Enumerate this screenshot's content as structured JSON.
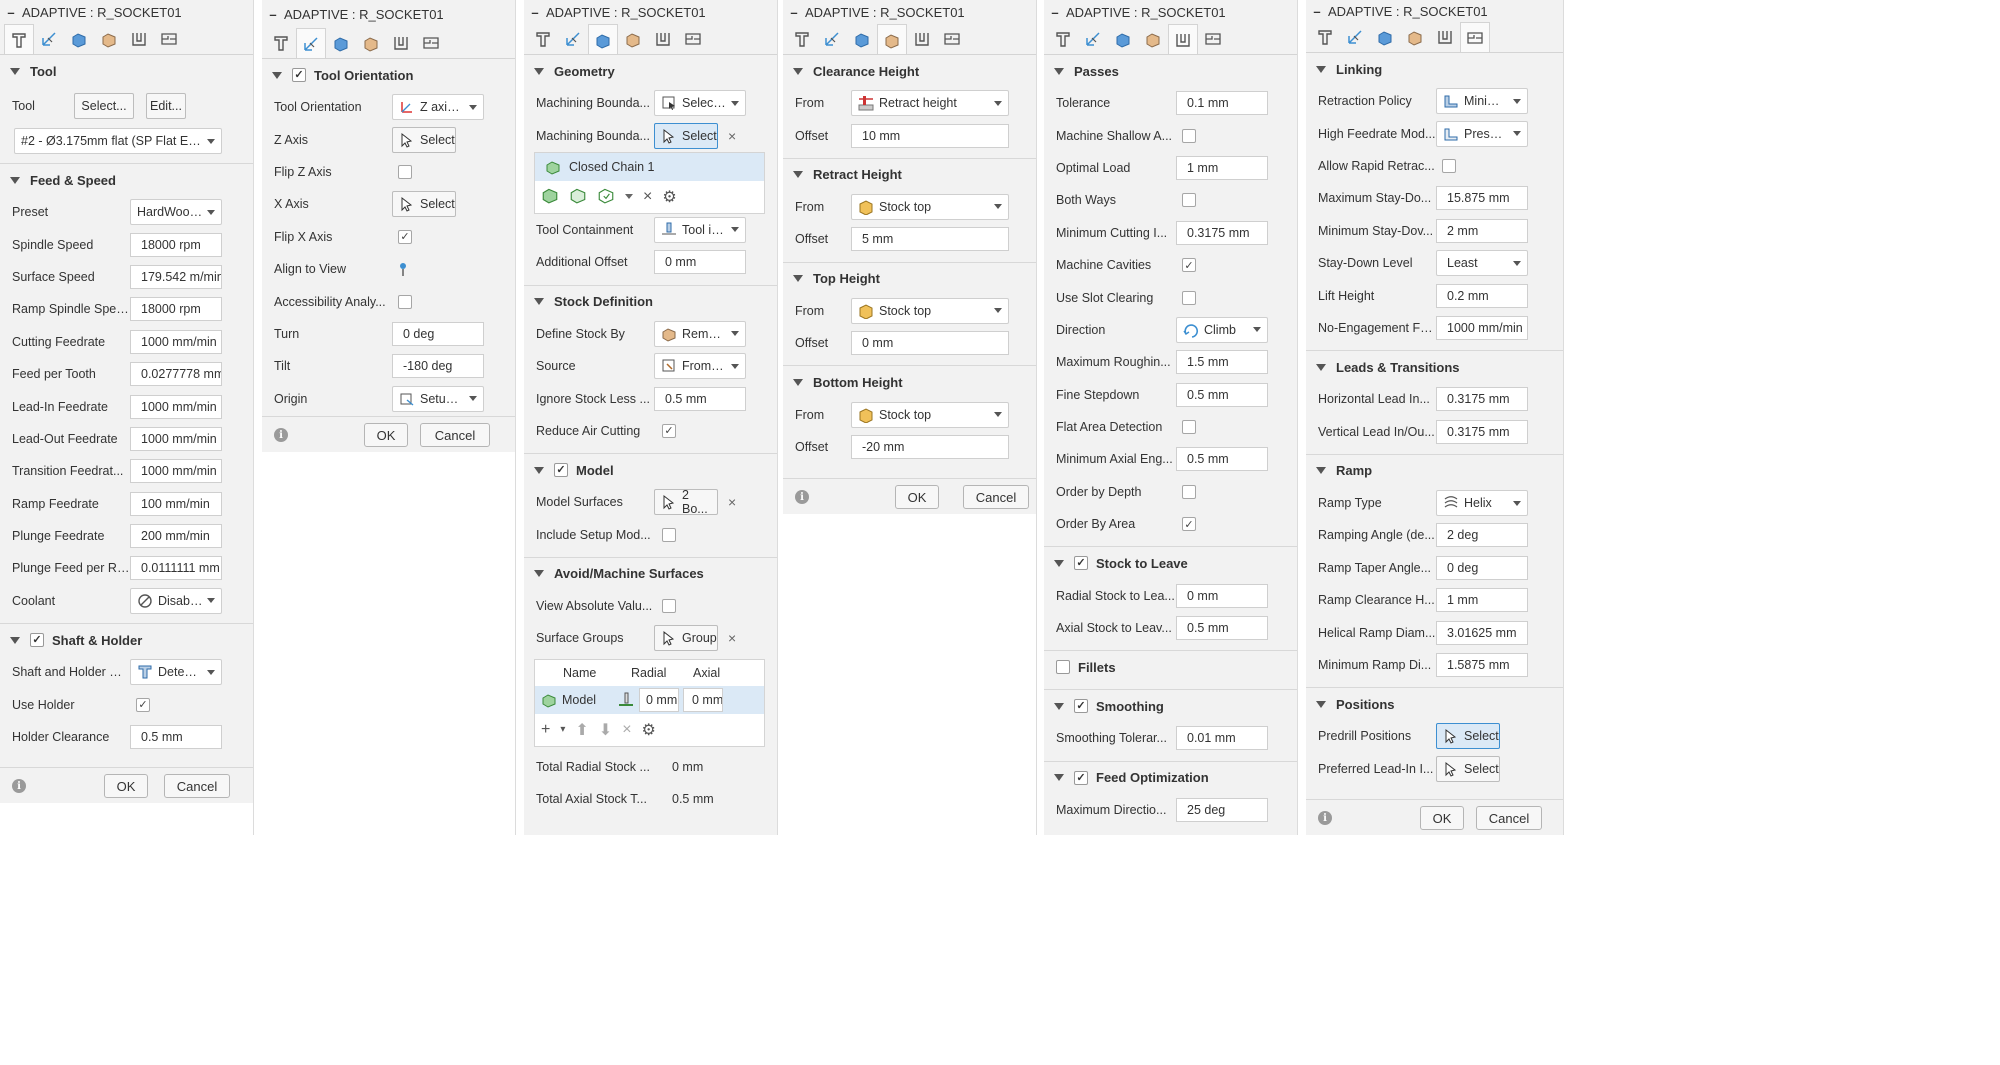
{
  "window_title": "ADAPTIVE : R_SOCKET01",
  "footer": {
    "ok": "OK",
    "cancel": "Cancel"
  },
  "tab_icons": [
    "tool-tab-icon",
    "geometry-tab-icon",
    "heights-tab-icon",
    "passes-tab-icon",
    "linking-tab-icon",
    "misc-tab-icon"
  ],
  "p1": {
    "tool": {
      "title": "Tool",
      "label": "Tool",
      "select": "Select...",
      "edit": "Edit...",
      "tool_value": "#2 - Ø3.175mm flat (SP Flat Enc..."
    },
    "feed": {
      "title": "Feed & Speed",
      "rows": [
        {
          "label": "Preset",
          "value": "HardWood ..."
        },
        {
          "label": "Spindle Speed",
          "value": "18000 rpm"
        },
        {
          "label": "Surface Speed",
          "value": "179.542 m/min"
        },
        {
          "label": "Ramp Spindle Spee...",
          "value": "18000 rpm"
        },
        {
          "label": "Cutting Feedrate",
          "value": "1000 mm/min"
        },
        {
          "label": "Feed per Tooth",
          "value": "0.0277778 mm"
        },
        {
          "label": "Lead-In Feedrate",
          "value": "1000 mm/min"
        },
        {
          "label": "Lead-Out Feedrate",
          "value": "1000 mm/min"
        },
        {
          "label": "Transition Feedrat...",
          "value": "1000 mm/min"
        },
        {
          "label": "Ramp Feedrate",
          "value": "100 mm/min"
        },
        {
          "label": "Plunge Feedrate",
          "value": "200 mm/min"
        },
        {
          "label": "Plunge Feed per Re...",
          "value": "0.0111111 mm"
        },
        {
          "label": "Coolant",
          "value": "Disabled"
        }
      ]
    },
    "shaft": {
      "title": "Shaft & Holder",
      "mode_label": "Shaft and Holder M...",
      "mode_value": "Detect t...",
      "use_holder": "Use Holder",
      "clearance_label": "Holder Clearance",
      "clearance_value": "0.5 mm"
    }
  },
  "p2": {
    "title": "Tool Orientation",
    "orientation_label": "Tool Orientation",
    "orientation_value": "Z axis/p...",
    "z_axis": "Z Axis",
    "select": "Select",
    "flip_z": "Flip Z Axis",
    "x_axis": "X Axis",
    "flip_x": "Flip X Axis",
    "align": "Align to View",
    "access": "Accessibility Analy...",
    "turn_label": "Turn",
    "turn_value": "0 deg",
    "tilt_label": "Tilt",
    "tilt_value": "-180 deg",
    "origin_label": "Origin",
    "origin_value": "Setup W..."
  },
  "p3": {
    "geometry": {
      "title": "Geometry",
      "mb1_label": "Machining Bounda...",
      "mb1_value": "Selection",
      "mb2_label": "Machining Bounda...",
      "mb2_select": "Select",
      "chain": "Closed Chain 1",
      "containment_label": "Tool Containment",
      "containment_value": "Tool ins...",
      "offset_label": "Additional Offset",
      "offset_value": "0 mm"
    },
    "stock": {
      "title": "Stock Definition",
      "define_label": "Define Stock By",
      "define_value": "Remaini...",
      "source_label": "Source",
      "source_value": "From pr...",
      "ignore_label": "Ignore Stock Less ...",
      "ignore_value": "0.5 mm",
      "reduce_label": "Reduce Air Cutting"
    },
    "model": {
      "title": "Model",
      "surfaces_label": "Model Surfaces",
      "surfaces_value": "2 Bo...",
      "include_label": "Include Setup Mod..."
    },
    "avoid": {
      "title": "Avoid/Machine Surfaces",
      "view_label": "View Absolute Valu...",
      "groups_label": "Surface Groups",
      "groups_value": "Group",
      "table": {
        "headers": [
          "Name",
          "Radial",
          "Axial"
        ],
        "row": [
          "Model",
          "0 mm",
          "0 mm"
        ]
      },
      "total_radial_label": "Total Radial Stock ...",
      "total_radial_value": "0 mm",
      "total_axial_label": "Total Axial Stock T...",
      "total_axial_value": "0.5 mm"
    }
  },
  "p4": {
    "from_label": "From",
    "offset_label": "Offset",
    "groups": [
      {
        "title": "Clearance Height",
        "from": "Retract height",
        "offset": "10 mm"
      },
      {
        "title": "Retract Height",
        "from": "Stock top",
        "offset": "5 mm"
      },
      {
        "title": "Top Height",
        "from": "Stock top",
        "offset": "0 mm"
      },
      {
        "title": "Bottom Height",
        "from": "Stock top",
        "offset": "-20 mm"
      }
    ]
  },
  "p5": {
    "passes": {
      "title": "Passes",
      "tolerance_label": "Tolerance",
      "tolerance_value": "0.1 mm",
      "shallow_label": "Machine Shallow A...",
      "load_label": "Optimal Load",
      "load_value": "1 mm",
      "both_label": "Both Ways",
      "mincut_label": "Minimum Cutting I...",
      "mincut_value": "0.3175 mm",
      "cavities_label": "Machine Cavities",
      "slot_label": "Use Slot Clearing",
      "direction_label": "Direction",
      "direction_value": "Climb",
      "maxrough_label": "Maximum Roughin...",
      "maxrough_value": "1.5 mm",
      "fine_label": "Fine Stepdown",
      "fine_value": "0.5 mm",
      "flat_label": "Flat Area Detection",
      "minaxial_label": "Minimum Axial Eng...",
      "minaxial_value": "0.5 mm",
      "depth_label": "Order by Depth",
      "area_label": "Order By Area"
    },
    "stock": {
      "title": "Stock to Leave",
      "radial_label": "Radial Stock to Lea...",
      "radial_value": "0 mm",
      "axial_label": "Axial Stock to Leav...",
      "axial_value": "0.5 mm"
    },
    "fillets": {
      "title": "Fillets"
    },
    "smoothing": {
      "title": "Smoothing",
      "tol_label": "Smoothing Tolerar...",
      "tol_value": "0.01 mm"
    },
    "feedopt": {
      "title": "Feed Optimization",
      "maxdir_label": "Maximum Directio...",
      "maxdir_value": "25 deg"
    }
  },
  "p6": {
    "linking": {
      "title": "Linking",
      "retract_label": "Retraction Policy",
      "retract_value": "Minimur...",
      "highfeed_label": "High Feedrate Mod...",
      "highfeed_value": "Preserve...",
      "rapid_label": "Allow Rapid Retrac...",
      "maxstay_label": "Maximum Stay-Do...",
      "maxstay_value": "15.875 mm",
      "minstay_label": "Minimum Stay-Dov...",
      "minstay_value": "2 mm",
      "level_label": "Stay-Down Level",
      "level_value": "Least",
      "lift_label": "Lift Height",
      "lift_value": "0.2 mm",
      "noeng_label": "No-Engagement Fe...",
      "noeng_value": "1000 mm/min"
    },
    "leads": {
      "title": "Leads & Transitions",
      "horiz_label": "Horizontal Lead In...",
      "horiz_value": "0.3175 mm",
      "vert_label": "Vertical Lead In/Ou...",
      "vert_value": "0.3175 mm"
    },
    "ramp": {
      "title": "Ramp",
      "type_label": "Ramp Type",
      "type_value": "Helix",
      "angle_label": "Ramping Angle (de...",
      "angle_value": "2 deg",
      "taper_label": "Ramp Taper Angle...",
      "taper_value": "0 deg",
      "clear_label": "Ramp Clearance H...",
      "clear_value": "1 mm",
      "helical_label": "Helical Ramp Diam...",
      "helical_value": "3.01625 mm",
      "minramp_label": "Minimum Ramp Di...",
      "minramp_value": "1.5875 mm"
    },
    "positions": {
      "title": "Positions",
      "predrill_label": "Predrill Positions",
      "preferred_label": "Preferred Lead-In I...",
      "select": "Select"
    }
  }
}
